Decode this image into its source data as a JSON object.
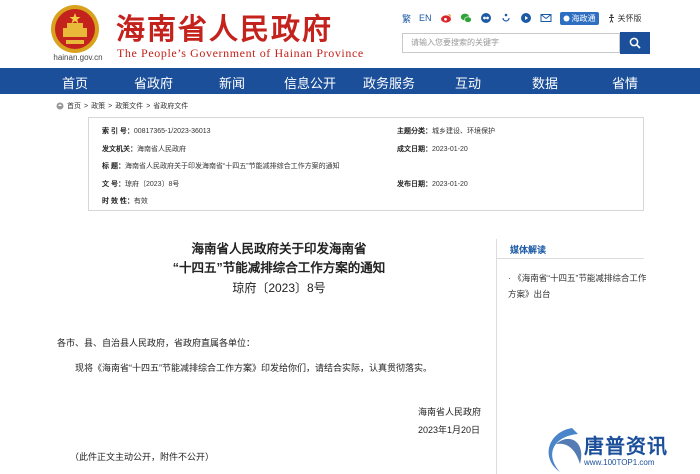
{
  "header": {
    "emblem_url": "hainan.gov.cn",
    "site_title": "海南省人民政府",
    "site_subtitle": "The People’s Government  of  Hainan Province",
    "toolbar": {
      "traditional": "繁",
      "english": "EN",
      "gov_app": "海政通",
      "care_mode": "关怀版"
    },
    "search_placeholder": "请输入您要搜索的关键字"
  },
  "nav": {
    "items": [
      "首页",
      "省政府",
      "新闻",
      "信息公开",
      "政务服务",
      "互动",
      "数据",
      "省情"
    ]
  },
  "breadcrumb": {
    "items": [
      "首页",
      "政策",
      "政策文件",
      "省政府文件"
    ],
    "separator": ">"
  },
  "info": {
    "index_label": "索 引 号：",
    "index_value": "00817365-1/2023-36013",
    "topic_label": "主题分类：",
    "topic_value": "城乡建设、环境保护",
    "issuer_label": "发文机关：",
    "issuer_value": "海南省人民政府",
    "date_label": "成文日期：",
    "date_value": "2023-01-20",
    "title_label": "标    题：",
    "title_value": "海南省人民政府关于印发海南省“十四五”节能减排综合工作方案的通知",
    "docno_label": "文    号：",
    "docno_value": "琼府〔2023〕8号",
    "publish_label": "发布日期：",
    "publish_value": "2023-01-20",
    "validity_label": "时 效 性：",
    "validity_value": "有效"
  },
  "article": {
    "title_line1": "海南省人民政府关于印发海南省",
    "title_line2": "“十四五”节能减排综合工作方案的通知",
    "doc_no": "琼府〔2023〕8号",
    "salutation": "各市、县、自治县人民政府，省政府直属各单位：",
    "paragraph": "现将《海南省“十四五”节能减排综合工作方案》印发给你们，请结合实际，认真贯彻落实。",
    "signature": "海南省人民政府",
    "sign_date": "2023年1月20日",
    "note": "（此件正文主动公开，附件不公开）"
  },
  "sidebar": {
    "title": "媒体解读",
    "links": [
      "《海南省“十四五”节能减排综合工作方案》出台"
    ]
  },
  "watermark": {
    "name": "唐普资讯",
    "url": "www.100TOP1.com"
  },
  "colors": {
    "brand_red": "#c4221c",
    "nav_blue": "#1b4f9a",
    "link_blue": "#1b5aa5"
  }
}
